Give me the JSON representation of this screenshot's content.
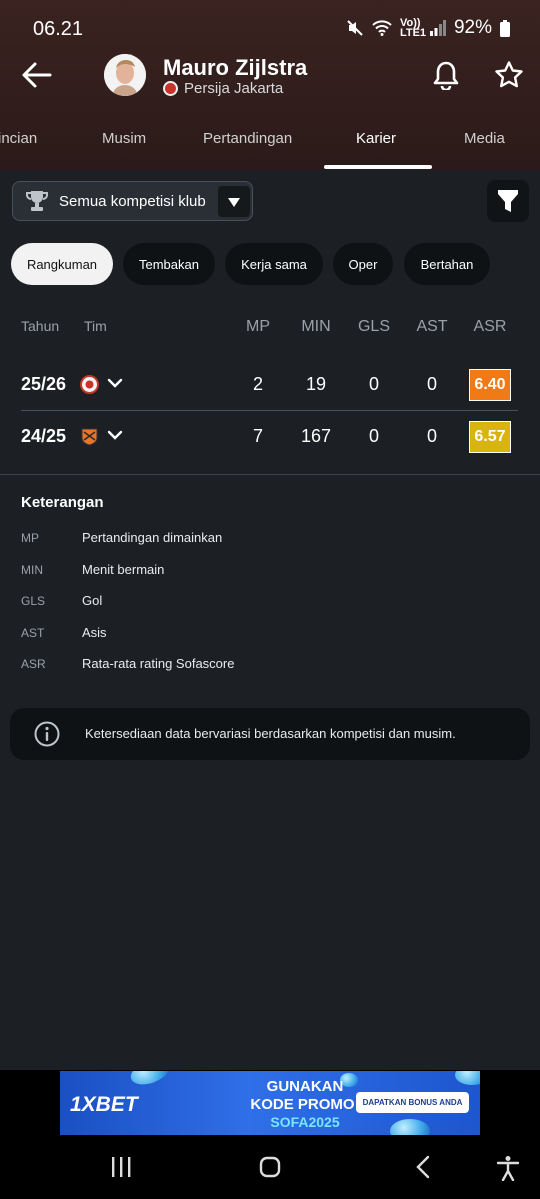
{
  "status": {
    "time": "06.21",
    "network": "Vo)) LTE1",
    "battery": "92%"
  },
  "header": {
    "player_name": "Mauro Zijlstra",
    "club": "Persija Jakarta"
  },
  "tabs": [
    "incian",
    "Musim",
    "Pertandingan",
    "Karier",
    "Media"
  ],
  "active_tab": "Karier",
  "competition_select": {
    "label": "Semua kompetisi klub"
  },
  "chips": [
    "Rangkuman",
    "Tembakan",
    "Kerja sama",
    "Oper",
    "Bertahan"
  ],
  "active_chip": "Rangkuman",
  "table": {
    "headers": {
      "season": "Tahun",
      "team": "Tim",
      "mp": "MP",
      "min": "MIN",
      "gls": "GLS",
      "ast": "AST",
      "asr": "ASR"
    },
    "rows": [
      {
        "season": "25/26",
        "mp": "2",
        "min": "19",
        "gls": "0",
        "ast": "0",
        "asr": "6.40",
        "rating_color": "#f07a16",
        "crest": "persija-crest-icon"
      },
      {
        "season": "24/25",
        "mp": "7",
        "min": "167",
        "gls": "0",
        "ast": "0",
        "asr": "6.57",
        "rating_color": "#d8b410",
        "crest": "orange-club-crest-icon"
      }
    ]
  },
  "legend": {
    "title": "Keterangan",
    "items": [
      {
        "abbr": "MP",
        "desc": "Pertandingan dimainkan"
      },
      {
        "abbr": "MIN",
        "desc": "Menit bermain"
      },
      {
        "abbr": "GLS",
        "desc": "Gol"
      },
      {
        "abbr": "AST",
        "desc": "Asis"
      },
      {
        "abbr": "ASR",
        "desc": "Rata-rata rating Sofascore"
      }
    ]
  },
  "info": {
    "text": "Ketersediaan data bervariasi berdasarkan kompetisi dan musim."
  },
  "ad": {
    "brand": "1XBET",
    "line1": "GUNAKAN",
    "line2": "KODE PROMO:",
    "line3": "SOFA2025",
    "cta": "DAPATKAN BONUS ANDA"
  }
}
